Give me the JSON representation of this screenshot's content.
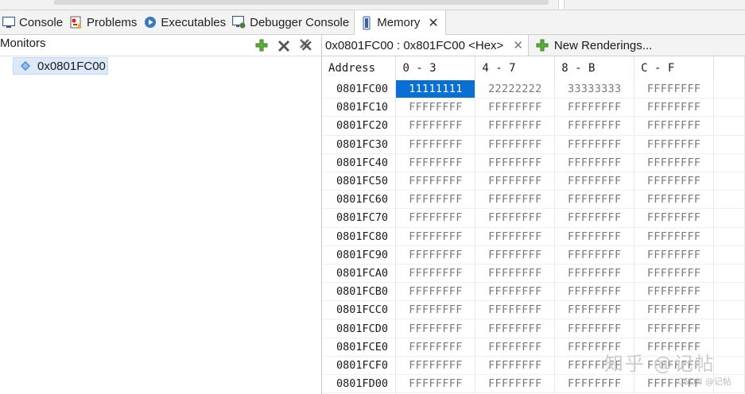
{
  "view_tabs": [
    {
      "label": "Console",
      "icon": "console-icon"
    },
    {
      "label": "Problems",
      "icon": "problems-icon"
    },
    {
      "label": "Executables",
      "icon": "executables-icon"
    },
    {
      "label": "Debugger Console",
      "icon": "debugger-console-icon"
    },
    {
      "label": "Memory",
      "icon": "memory-icon",
      "active": true,
      "close": "✕"
    }
  ],
  "monitors": {
    "title": "Monitors",
    "tools": [
      "add-monitor-icon",
      "remove-monitor-icon",
      "remove-all-monitors-icon"
    ],
    "items": [
      {
        "label": "0x0801FC00"
      }
    ]
  },
  "memory": {
    "rendering_tab": {
      "label": "0x0801FC00 : 0x801FC00 <Hex>",
      "close": "✕"
    },
    "new_renderings_label": "New Renderings...",
    "columns": [
      "Address",
      "0 - 3",
      "4 - 7",
      "8 - B",
      "C - F"
    ],
    "rows": [
      {
        "addr": "0801FC00",
        "cells": [
          "11111111",
          "22222222",
          "33333333",
          "FFFFFFFF"
        ],
        "selected": 0
      },
      {
        "addr": "0801FC10",
        "cells": [
          "FFFFFFFF",
          "FFFFFFFF",
          "FFFFFFFF",
          "FFFFFFFF"
        ]
      },
      {
        "addr": "0801FC20",
        "cells": [
          "FFFFFFFF",
          "FFFFFFFF",
          "FFFFFFFF",
          "FFFFFFFF"
        ]
      },
      {
        "addr": "0801FC30",
        "cells": [
          "FFFFFFFF",
          "FFFFFFFF",
          "FFFFFFFF",
          "FFFFFFFF"
        ]
      },
      {
        "addr": "0801FC40",
        "cells": [
          "FFFFFFFF",
          "FFFFFFFF",
          "FFFFFFFF",
          "FFFFFFFF"
        ]
      },
      {
        "addr": "0801FC50",
        "cells": [
          "FFFFFFFF",
          "FFFFFFFF",
          "FFFFFFFF",
          "FFFFFFFF"
        ]
      },
      {
        "addr": "0801FC60",
        "cells": [
          "FFFFFFFF",
          "FFFFFFFF",
          "FFFFFFFF",
          "FFFFFFFF"
        ]
      },
      {
        "addr": "0801FC70",
        "cells": [
          "FFFFFFFF",
          "FFFFFFFF",
          "FFFFFFFF",
          "FFFFFFFF"
        ]
      },
      {
        "addr": "0801FC80",
        "cells": [
          "FFFFFFFF",
          "FFFFFFFF",
          "FFFFFFFF",
          "FFFFFFFF"
        ]
      },
      {
        "addr": "0801FC90",
        "cells": [
          "FFFFFFFF",
          "FFFFFFFF",
          "FFFFFFFF",
          "FFFFFFFF"
        ]
      },
      {
        "addr": "0801FCA0",
        "cells": [
          "FFFFFFFF",
          "FFFFFFFF",
          "FFFFFFFF",
          "FFFFFFFF"
        ]
      },
      {
        "addr": "0801FCB0",
        "cells": [
          "FFFFFFFF",
          "FFFFFFFF",
          "FFFFFFFF",
          "FFFFFFFF"
        ]
      },
      {
        "addr": "0801FCC0",
        "cells": [
          "FFFFFFFF",
          "FFFFFFFF",
          "FFFFFFFF",
          "FFFFFFFF"
        ]
      },
      {
        "addr": "0801FCD0",
        "cells": [
          "FFFFFFFF",
          "FFFFFFFF",
          "FFFFFFFF",
          "FFFFFFFF"
        ]
      },
      {
        "addr": "0801FCE0",
        "cells": [
          "FFFFFFFF",
          "FFFFFFFF",
          "FFFFFFFF",
          "FFFFFFFF"
        ]
      },
      {
        "addr": "0801FCF0",
        "cells": [
          "FFFFFFFF",
          "FFFFFFFF",
          "FFFFFFFF",
          "FFFFFFFF"
        ]
      },
      {
        "addr": "0801FD00",
        "cells": [
          "FFFFFFFF",
          "FFFFFFFF",
          "FFFFFFFF",
          "FFFFFFFF"
        ]
      }
    ]
  },
  "watermark": {
    "text": "知乎 @记帖",
    "small": "CSDN @记帖"
  },
  "colors": {
    "selection": "#0a6fd3",
    "monitor_highlight": "#dbe9fa"
  }
}
